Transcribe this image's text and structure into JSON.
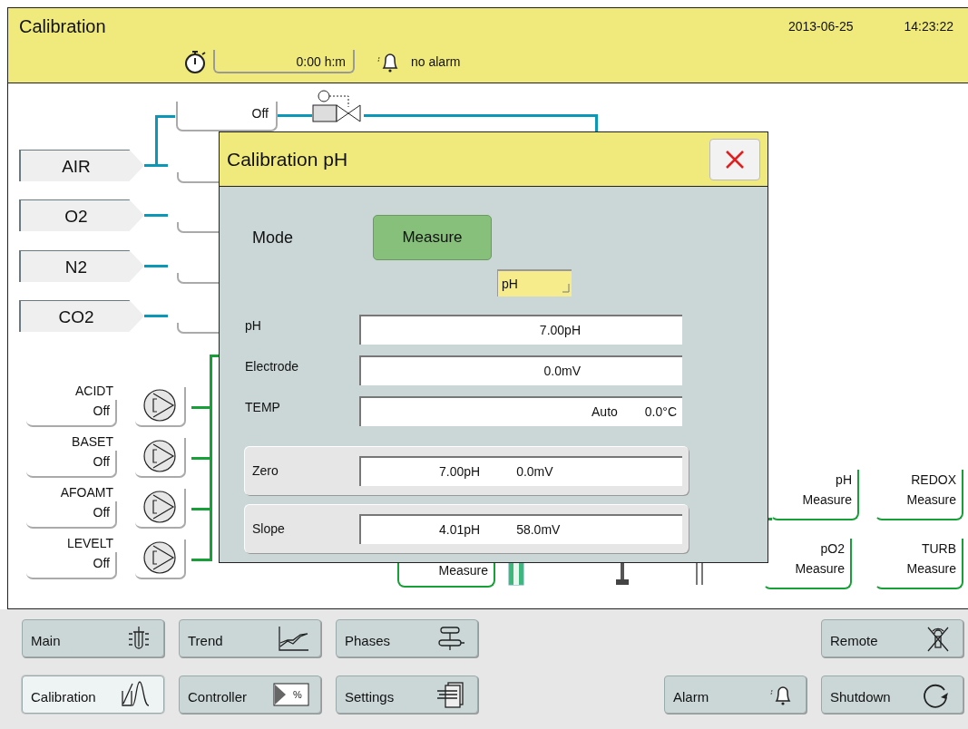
{
  "header": {
    "title": "Calibration",
    "date": "2013-06-25",
    "time": "14:23:22",
    "timer": "0:00 h:m",
    "alarm": "no alarm"
  },
  "diagram": {
    "valve_state": "Off",
    "gases": [
      {
        "label": "AIR"
      },
      {
        "label": "O2"
      },
      {
        "label": "N2"
      },
      {
        "label": "CO2"
      }
    ],
    "pumps": [
      {
        "name": "ACIDT",
        "state": "Off"
      },
      {
        "name": "BASET",
        "state": "Off"
      },
      {
        "name": "AFOAMT",
        "state": "Off"
      },
      {
        "name": "LEVELT",
        "state": "Off"
      }
    ],
    "partial_sensor": "Measure",
    "sensors": [
      {
        "name": "pH",
        "state": "Measure"
      },
      {
        "name": "REDOX",
        "state": "Measure"
      },
      {
        "name": "pO2",
        "state": "Measure"
      },
      {
        "name": "TURB",
        "state": "Measure"
      }
    ]
  },
  "dialog": {
    "title": "Calibration pH",
    "mode_label": "Mode",
    "mode_button": "Measure",
    "selector": "pH",
    "fields": [
      {
        "label": "pH",
        "values": [
          "7.00pH"
        ]
      },
      {
        "label": "Electrode",
        "values": [
          "0.0mV"
        ]
      },
      {
        "label": "TEMP",
        "values": [
          "Auto",
          "0.0°C"
        ]
      }
    ],
    "actions": [
      {
        "label": "Zero",
        "values": [
          "7.00pH",
          "0.0mV"
        ]
      },
      {
        "label": "Slope",
        "values": [
          "4.01pH",
          "58.0mV"
        ]
      }
    ]
  },
  "nav": [
    {
      "left": [
        {
          "label": "Main",
          "kind": "main",
          "selected": false
        },
        {
          "label": "Trend",
          "kind": "trend",
          "selected": false
        },
        {
          "label": "Phases",
          "kind": "phases",
          "selected": false
        }
      ],
      "right": [
        {
          "label": "Remote",
          "kind": "remote",
          "selected": false
        }
      ]
    },
    {
      "left": [
        {
          "label": "Calibration",
          "kind": "calibration",
          "selected": true
        },
        {
          "label": "Controller",
          "kind": "controller",
          "selected": false,
          "icon_text": "%"
        },
        {
          "label": "Settings",
          "kind": "settings",
          "selected": false
        }
      ],
      "right": [
        {
          "label": "Alarm",
          "kind": "alarm",
          "selected": false
        },
        {
          "label": "Shutdown",
          "kind": "shutdown",
          "selected": false
        }
      ]
    }
  ]
}
